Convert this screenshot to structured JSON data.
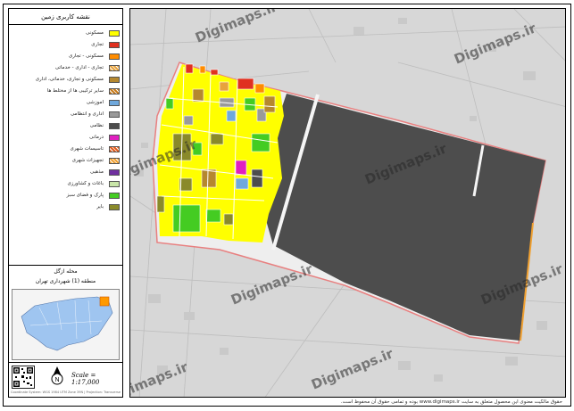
{
  "legend": {
    "title": "نقشه کاربری زمین",
    "items": [
      {
        "label": "مسکونی",
        "color": "#ffff00",
        "pattern": "solid"
      },
      {
        "label": "تجاری",
        "color": "#e03020",
        "pattern": "solid"
      },
      {
        "label": "مسکونی - تجاری",
        "color": "#ff8c00",
        "pattern": "solid"
      },
      {
        "label": "تجاری - اداری - خدماتی",
        "color": "#e8a33c",
        "pattern": "hatch"
      },
      {
        "label": "مسکونی و تجاری، خدماتی، اداری",
        "color": "#b5882f",
        "pattern": "solid"
      },
      {
        "label": "سایر ترکیبی ها از مختلط ها",
        "color": "#c77a1a",
        "pattern": "hatch"
      },
      {
        "label": "آموزشی",
        "color": "#6fa8dc",
        "pattern": "solid"
      },
      {
        "label": "اداری و انتظامی",
        "color": "#999999",
        "pattern": "solid"
      },
      {
        "label": "نظامی",
        "color": "#4d4d4d",
        "pattern": "solid"
      },
      {
        "label": "درمانی",
        "color": "#e020c0",
        "pattern": "solid"
      },
      {
        "label": "تاسیسات شهری",
        "color": "#e05a1a",
        "pattern": "hatch"
      },
      {
        "label": "تجهیزات شهری",
        "color": "#f0a030",
        "pattern": "hatch"
      },
      {
        "label": "مذهبی",
        "color": "#7030a0",
        "pattern": "solid"
      },
      {
        "label": "باغات و کشاورزی",
        "color": "#c9e6a8",
        "pattern": "solid"
      },
      {
        "label": "پارک و فضای سبز",
        "color": "#44cc22",
        "pattern": "solid"
      },
      {
        "label": "بایر",
        "color": "#8a8a2a",
        "pattern": "solid"
      }
    ]
  },
  "district": {
    "title": "محله ازگل",
    "subtitle": "منطقه (1) شهرداری تهران"
  },
  "scale": "Scale = 1:17,000",
  "north_label": "N",
  "footer_small": "Coordinate System: WGS 1984 UTM Zone 39N | Projection: Transverse Mercator",
  "credit": "حقوق مالکیت معنوی این محصول متعلق به سایت www.digimaps.ir بوده و تمامی حقوق آن محفوظ است.",
  "watermark": "Digimaps.ir",
  "colors": {
    "military": "#4d4d4d",
    "residential": "#ffff00",
    "park": "#44cc22",
    "boundary": "#e88080",
    "background": "#d7d7d7"
  }
}
